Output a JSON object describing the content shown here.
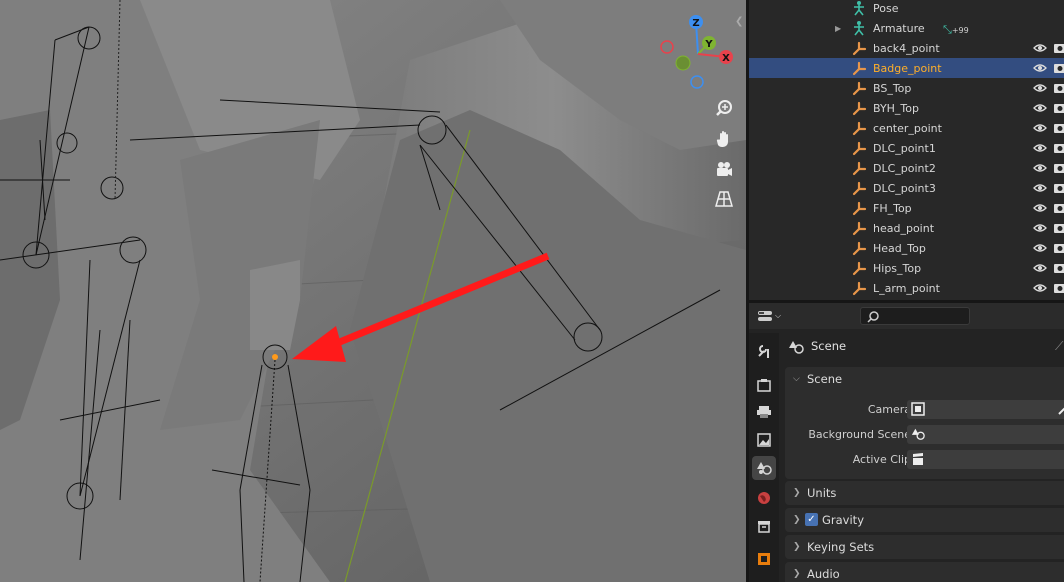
{
  "outliner": {
    "rows": [
      {
        "label": "Pose",
        "icon": "pose-icon",
        "selected": false
      },
      {
        "label": "Armature",
        "icon": "armature-icon",
        "selected": false,
        "badge": "+99"
      },
      {
        "label": "back4_point",
        "icon": "bone-icon",
        "selected": false
      },
      {
        "label": "Badge_point",
        "icon": "bone-icon",
        "selected": true
      },
      {
        "label": "BS_Top",
        "icon": "bone-icon",
        "selected": false
      },
      {
        "label": "BYH_Top",
        "icon": "bone-icon",
        "selected": false
      },
      {
        "label": "center_point",
        "icon": "bone-icon",
        "selected": false
      },
      {
        "label": "DLC_point1",
        "icon": "bone-icon",
        "selected": false
      },
      {
        "label": "DLC_point2",
        "icon": "bone-icon",
        "selected": false
      },
      {
        "label": "DLC_point3",
        "icon": "bone-icon",
        "selected": false
      },
      {
        "label": "FH_Top",
        "icon": "bone-icon",
        "selected": false
      },
      {
        "label": "head_point",
        "icon": "bone-icon",
        "selected": false
      },
      {
        "label": "Head_Top",
        "icon": "bone-icon",
        "selected": false
      },
      {
        "label": "Hips_Top",
        "icon": "bone-icon",
        "selected": false
      },
      {
        "label": "L_arm_point",
        "icon": "bone-icon",
        "selected": false
      }
    ]
  },
  "gizmo": {
    "z": "Z",
    "y": "Y",
    "x": "X"
  },
  "properties": {
    "title": "Scene",
    "panel_scene": {
      "title": "Scene",
      "camera_label": "Camera",
      "background_scene_label": "Background Scene",
      "active_clip_label": "Active Clip"
    },
    "panels": [
      {
        "title": "Units",
        "checkbox": false
      },
      {
        "title": "Gravity",
        "checkbox": true,
        "checked": true
      },
      {
        "title": "Keying Sets",
        "checkbox": false
      },
      {
        "title": "Audio",
        "checkbox": false
      }
    ]
  },
  "colors": {
    "selected_row": "#334d80",
    "selected_text": "#ffaf29",
    "arrow": "#ff1a1a",
    "axis_x": "#e8424c",
    "axis_y": "#7fb431",
    "axis_z": "#3d8ff0"
  }
}
